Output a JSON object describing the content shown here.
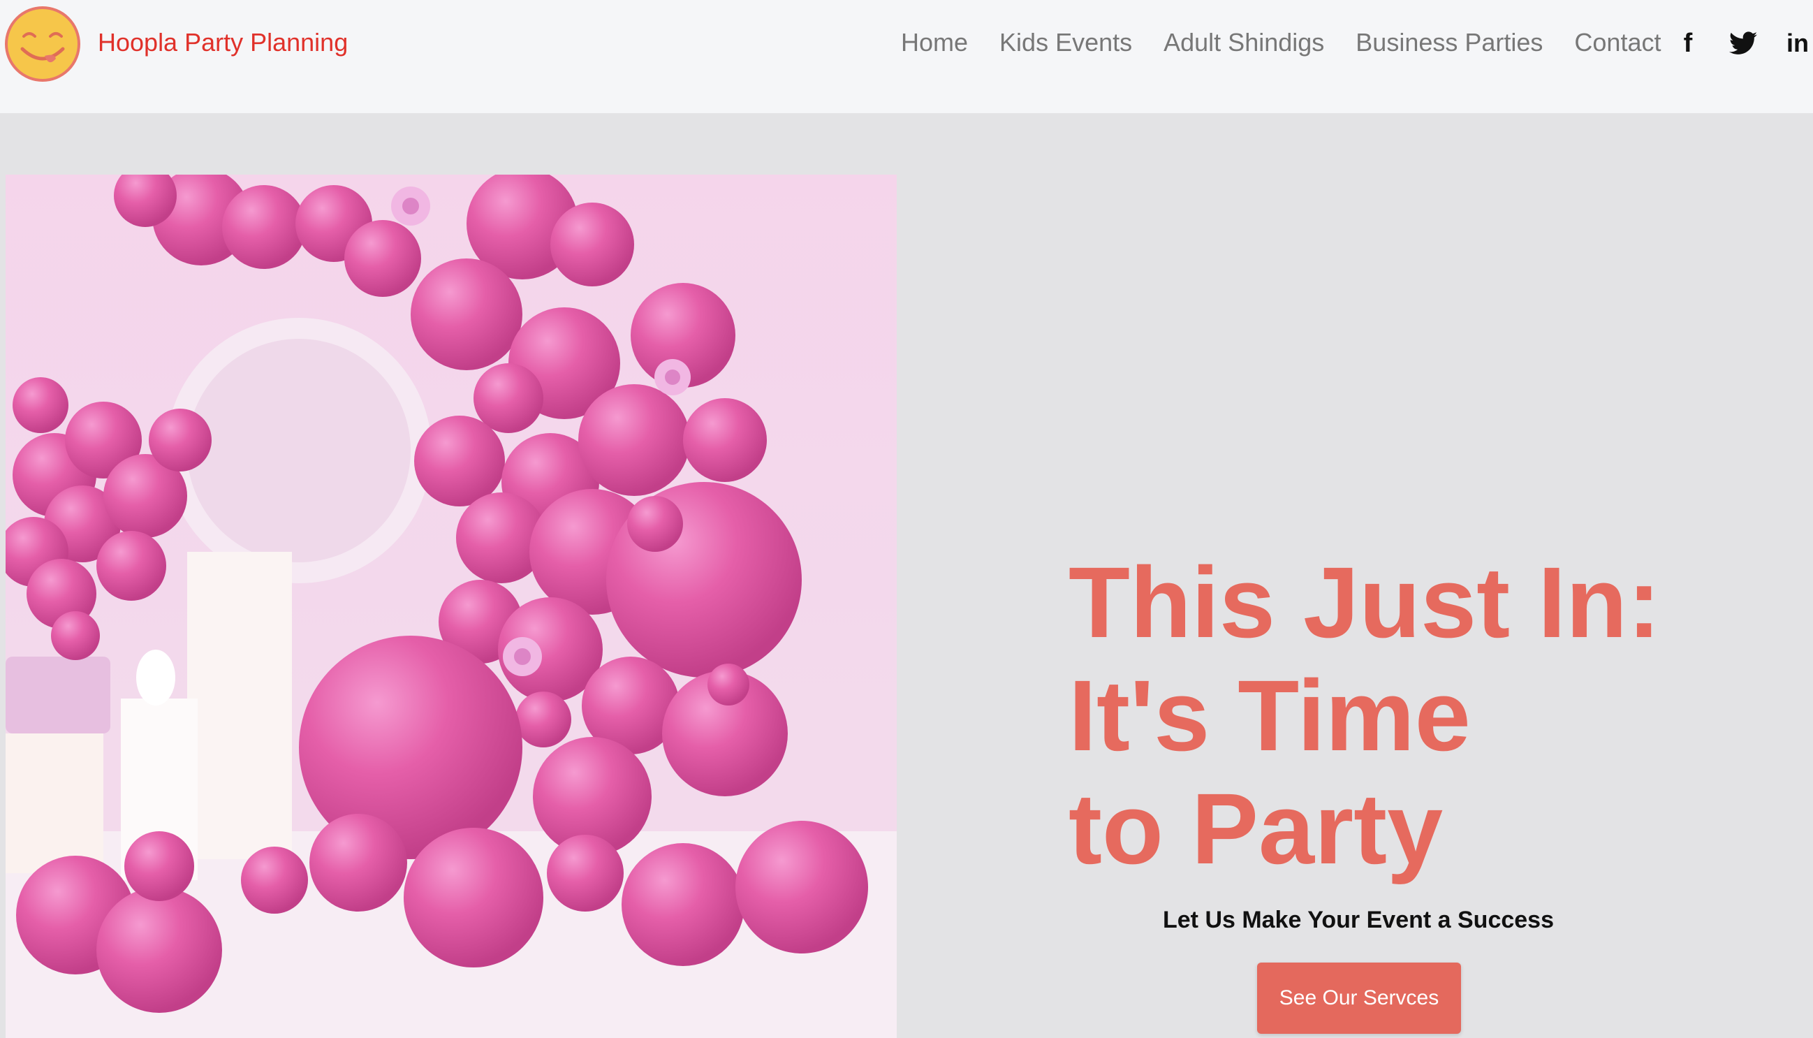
{
  "brand": {
    "name": "Hoopla Party Planning",
    "logo_icon": "smiley-tongue-icon"
  },
  "nav": {
    "items": [
      {
        "label": "Home"
      },
      {
        "label": "Kids Events"
      },
      {
        "label": "Adult Shindigs"
      },
      {
        "label": "Business Parties"
      },
      {
        "label": "Contact"
      }
    ]
  },
  "social": {
    "facebook": {
      "icon": "facebook-icon",
      "glyph": "f"
    },
    "twitter": {
      "icon": "twitter-icon"
    },
    "linkedin": {
      "icon": "linkedin-icon",
      "glyph": "in"
    }
  },
  "hero": {
    "headline_lines": [
      "This Just In:",
      "It's Time",
      "to Party"
    ],
    "tagline": "Let Us Make Your Event a Success",
    "cta_label": "See Our Servces",
    "image_icon": "pink-balloon-arch-image"
  },
  "colors": {
    "brand_red": "#e0312a",
    "headline_coral": "#e66a5e",
    "cta_bg": "#e4695d",
    "header_bg": "#f5f6f8",
    "page_bg": "#e3e3e5",
    "balloon_pink": "#e35fa8"
  }
}
